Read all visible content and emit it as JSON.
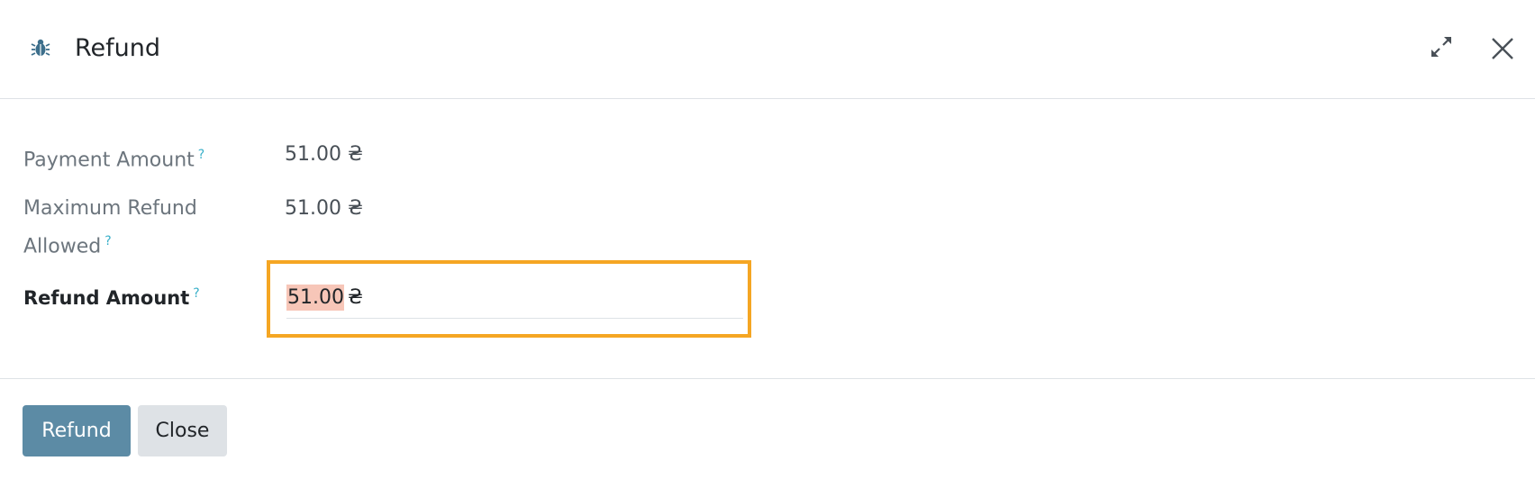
{
  "dialog": {
    "title": "Refund",
    "icons": {
      "title_icon": "bug-icon",
      "expand": "expand-arrows-icon",
      "close": "close-icon"
    }
  },
  "form": {
    "payment_amount": {
      "label": "Payment Amount",
      "help": "?",
      "value": "51.00 ₴"
    },
    "max_refund": {
      "label": "Maximum Refund Allowed",
      "help": "?",
      "value": "51.00 ₴"
    },
    "refund_amount": {
      "label": "Refund Amount",
      "help": "?",
      "value": "51.00",
      "currency": "₴"
    }
  },
  "footer": {
    "refund_label": "Refund",
    "close_label": "Close"
  },
  "colors": {
    "primary": "#5c8ba5",
    "secondary": "#dee2e6",
    "highlight_border": "#f5a623",
    "selection": "#f7c6b8",
    "help": "#3ab0c9"
  }
}
